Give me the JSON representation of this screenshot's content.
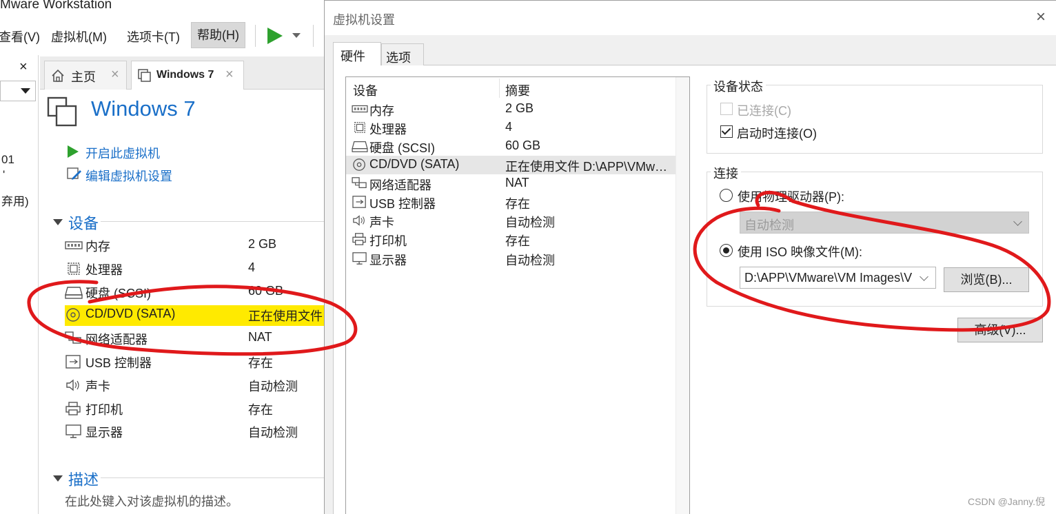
{
  "app": {
    "title": "Mware Workstation"
  },
  "menu": {
    "view": "查看(V)",
    "vm": "虚拟机(M)",
    "tabs": "选项卡(T)",
    "help": "帮助(H)"
  },
  "library": {
    "close": "×",
    "frag_1": "01",
    "frag_2": "'",
    "frag_3": "弃用)"
  },
  "tabs": {
    "home": "主页",
    "vm": "Windows 7",
    "close": "×"
  },
  "vm": {
    "name": "Windows 7",
    "actions": {
      "power_on": "开启此虚拟机",
      "edit_settings": "编辑虚拟机设置"
    },
    "devices_heading": "设备",
    "devices": [
      {
        "icon": "memory-icon",
        "name": "内存",
        "summary": "2 GB"
      },
      {
        "icon": "processor-icon",
        "name": "处理器",
        "summary": "4"
      },
      {
        "icon": "hard-disk-icon",
        "name": "硬盘 (SCSI)",
        "summary": "60 GB"
      },
      {
        "icon": "cd-dvd-icon",
        "name": "CD/DVD (SATA)",
        "summary": "正在使用文件"
      },
      {
        "icon": "network-adapter-icon",
        "name": "网络适配器",
        "summary": "NAT"
      },
      {
        "icon": "usb-controller-icon",
        "name": "USB 控制器",
        "summary": "存在"
      },
      {
        "icon": "sound-card-icon",
        "name": "声卡",
        "summary": "自动检测"
      },
      {
        "icon": "printer-icon",
        "name": "打印机",
        "summary": "存在"
      },
      {
        "icon": "display-icon",
        "name": "显示器",
        "summary": "自动检测"
      }
    ],
    "description_heading": "描述",
    "description_placeholder": "在此处键入对该虚拟机的描述。"
  },
  "dialog": {
    "title": "虚拟机设置",
    "close": "×",
    "tabs": {
      "hardware": "硬件",
      "options": "选项"
    },
    "hardware_list": {
      "col_device": "设备",
      "col_summary": "摘要",
      "rows": [
        {
          "icon": "memory-icon",
          "name": "内存",
          "summary": "2 GB",
          "selected": false
        },
        {
          "icon": "processor-icon",
          "name": "处理器",
          "summary": "4",
          "selected": false
        },
        {
          "icon": "hard-disk-icon",
          "name": "硬盘 (SCSI)",
          "summary": "60 GB",
          "selected": false
        },
        {
          "icon": "cd-dvd-icon",
          "name": "CD/DVD (SATA)",
          "summary": "正在使用文件 D:\\APP\\VMwar...",
          "selected": true
        },
        {
          "icon": "network-adapter-icon",
          "name": "网络适配器",
          "summary": "NAT",
          "selected": false
        },
        {
          "icon": "usb-controller-icon",
          "name": "USB 控制器",
          "summary": "存在",
          "selected": false
        },
        {
          "icon": "sound-card-icon",
          "name": "声卡",
          "summary": "自动检测",
          "selected": false
        },
        {
          "icon": "printer-icon",
          "name": "打印机",
          "summary": "存在",
          "selected": false
        },
        {
          "icon": "display-icon",
          "name": "显示器",
          "summary": "自动检测",
          "selected": false
        }
      ]
    },
    "device_status": {
      "title": "设备状态",
      "connected": {
        "label": "已连接(C)",
        "checked": false,
        "enabled": false
      },
      "connect_at_power_on": {
        "label": "启动时连接(O)",
        "checked": true,
        "enabled": true
      }
    },
    "connection": {
      "title": "连接",
      "physical_drive": {
        "label": "使用物理驱动器(P):",
        "selected": false,
        "value": "自动检测"
      },
      "iso_image": {
        "label": "使用 ISO 映像文件(M):",
        "selected": true,
        "value": "D:\\APP\\VMware\\VM Images\\V"
      },
      "browse": "浏览(B)...",
      "advanced": "高级(V)..."
    }
  },
  "annotations": {
    "highlight_color": "#ffea00",
    "ink_color": "#e0191b"
  },
  "watermark": "CSDN @Janny.倪"
}
